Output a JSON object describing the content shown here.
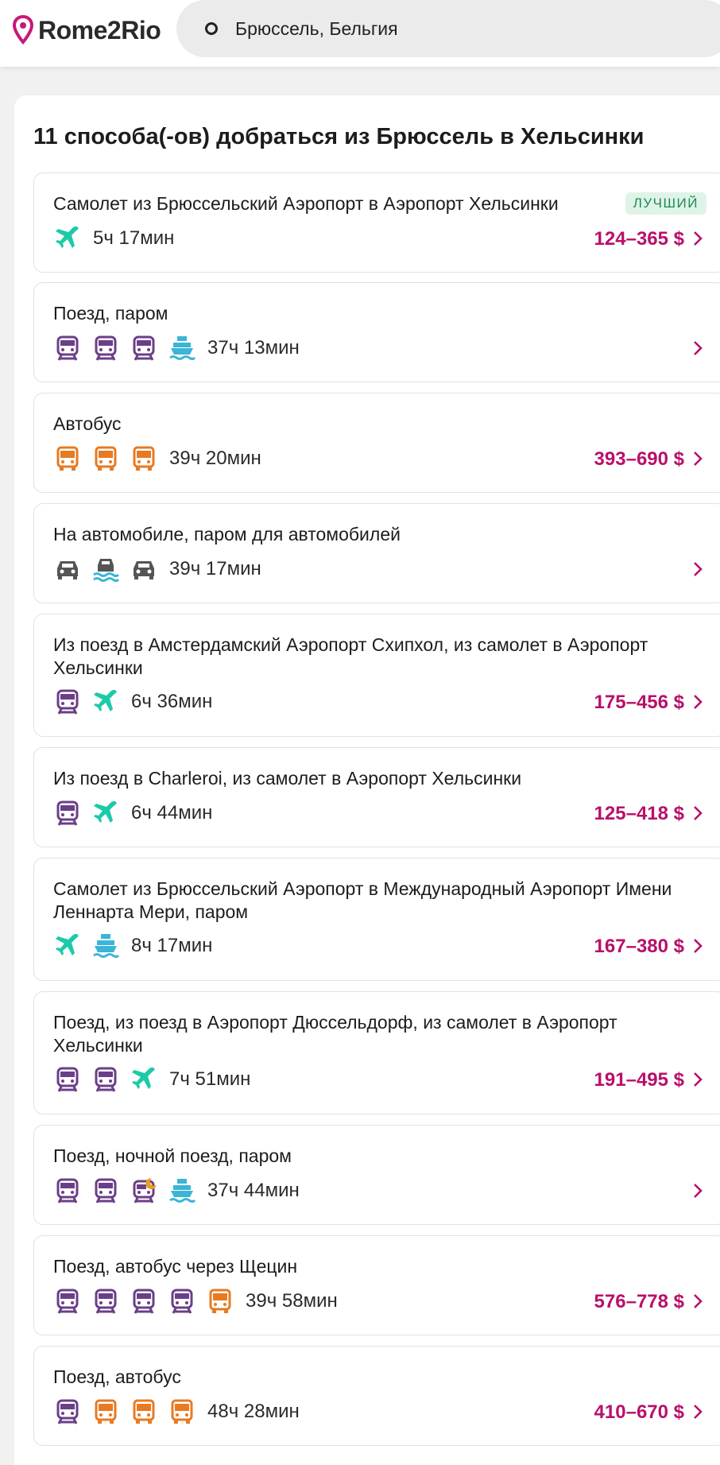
{
  "header": {
    "logo_text": "Rome2Rio",
    "search_value": "Брюссель, Бельгия"
  },
  "main": {
    "title": "11 способа(-ов) добраться из Брюссель в Хельсинки",
    "best_badge": "ЛУЧШИЙ",
    "colors": {
      "accent": "#b8106a",
      "train": "#6b3f88",
      "plane": "#1ccaa8",
      "bus": "#e87a22",
      "ferry": "#3bb5d6",
      "car": "#555555"
    },
    "routes": [
      {
        "title": "Самолет из Брюссельский Аэропорт в Аэропорт Хельсинки",
        "icons": [
          "plane-icon"
        ],
        "duration": "5ч 17мин",
        "price": "124–365 $",
        "best": true
      },
      {
        "title": "Поезд, паром",
        "icons": [
          "train-icon",
          "train-icon",
          "train-icon",
          "ferry-icon"
        ],
        "duration": "37ч 13мин",
        "price": ""
      },
      {
        "title": "Автобус",
        "icons": [
          "bus-icon",
          "bus-icon",
          "bus-icon"
        ],
        "duration": "39ч 20мин",
        "price": "393–690 $"
      },
      {
        "title": "На автомобиле, паром для автомобилей",
        "icons": [
          "car-icon",
          "car-ferry-icon",
          "car-icon"
        ],
        "duration": "39ч 17мин",
        "price": ""
      },
      {
        "title": "Из поезд в Амстердамский Аэропорт Схипхол, из самолет в Аэропорт Хельсинки",
        "icons": [
          "train-icon",
          "plane-icon"
        ],
        "duration": "6ч 36мин",
        "price": "175–456 $"
      },
      {
        "title": "Из поезд в Charleroi, из самолет в Аэропорт Хельсинки",
        "icons": [
          "train-icon",
          "plane-icon"
        ],
        "duration": "6ч 44мин",
        "price": "125–418 $"
      },
      {
        "title": "Самолет из Брюссельский Аэропорт в Международный Аэропорт Имени Леннарта Мери, паром",
        "icons": [
          "plane-icon",
          "ferry-icon"
        ],
        "duration": "8ч 17мин",
        "price": "167–380 $"
      },
      {
        "title": "Поезд, из поезд в Аэропорт Дюссельдорф, из самолет в Аэропорт Хельсинки",
        "icons": [
          "train-icon",
          "train-icon",
          "plane-icon"
        ],
        "duration": "7ч 51мин",
        "price": "191–495 $"
      },
      {
        "title": "Поезд, ночной поезд, паром",
        "icons": [
          "train-icon",
          "train-icon",
          "night-train-icon",
          "ferry-icon"
        ],
        "duration": "37ч 44мин",
        "price": ""
      },
      {
        "title": "Поезд, автобус через Щецин",
        "icons": [
          "train-icon",
          "train-icon",
          "train-icon",
          "train-icon",
          "bus-icon"
        ],
        "duration": "39ч 58мин",
        "price": "576–778 $"
      },
      {
        "title": "Поезд, автобус",
        "icons": [
          "train-icon",
          "bus-icon",
          "bus-icon",
          "bus-icon"
        ],
        "duration": "48ч 28мин",
        "price": "410–670 $"
      }
    ]
  }
}
